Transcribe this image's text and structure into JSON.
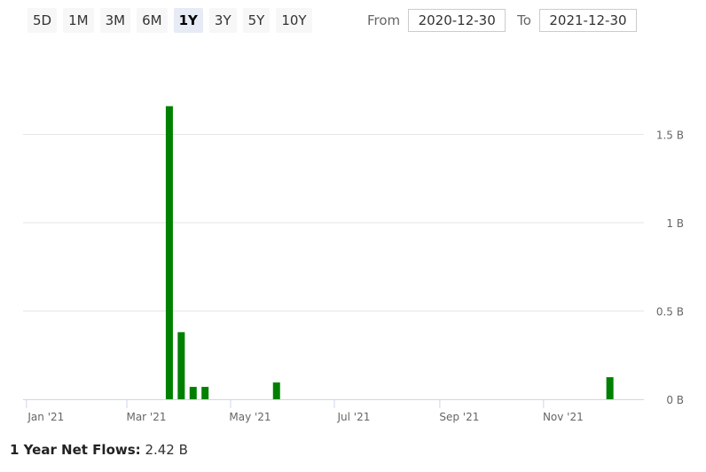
{
  "range_buttons": [
    "5D",
    "1M",
    "3M",
    "6M",
    "1Y",
    "3Y",
    "5Y",
    "10Y"
  ],
  "range_selected": "1Y",
  "date_range": {
    "from_label": "From",
    "from_value": "2020-12-30",
    "to_label": "To",
    "to_value": "2021-12-30"
  },
  "colors": {
    "bar": "#008000",
    "grid": "#e6e6e6",
    "axis": "#ccd6eb",
    "active_button": "#e6ebf5"
  },
  "chart_data": {
    "type": "bar",
    "x_range": [
      "2020-12-30",
      "2021-12-30"
    ],
    "ylim": [
      0,
      1.65
    ],
    "y_unit": "B",
    "y_ticks": [
      {
        "value": 0,
        "label": "0 B"
      },
      {
        "value": 0.5,
        "label": "0.5 B"
      },
      {
        "value": 1,
        "label": "1 B"
      },
      {
        "value": 1.5,
        "label": "1.5 B"
      }
    ],
    "x_ticks": [
      {
        "date": "2021-01-01",
        "label": "Jan '21"
      },
      {
        "date": "2021-03-01",
        "label": "Mar '21"
      },
      {
        "date": "2021-05-01",
        "label": "May '21"
      },
      {
        "date": "2021-07-01",
        "label": "Jul '21"
      },
      {
        "date": "2021-09-01",
        "label": "Sep '21"
      },
      {
        "date": "2021-11-01",
        "label": "Nov '21"
      }
    ],
    "points": [
      {
        "date": "2021-03-26",
        "value": 1.66
      },
      {
        "date": "2021-04-02",
        "value": 0.38
      },
      {
        "date": "2021-04-09",
        "value": 0.07
      },
      {
        "date": "2021-04-16",
        "value": 0.07
      },
      {
        "date": "2021-05-28",
        "value": 0.095
      },
      {
        "date": "2021-12-10",
        "value": 0.125
      }
    ]
  },
  "summary": {
    "label": "1 Year Net Flows:",
    "value": "2.42 B"
  }
}
